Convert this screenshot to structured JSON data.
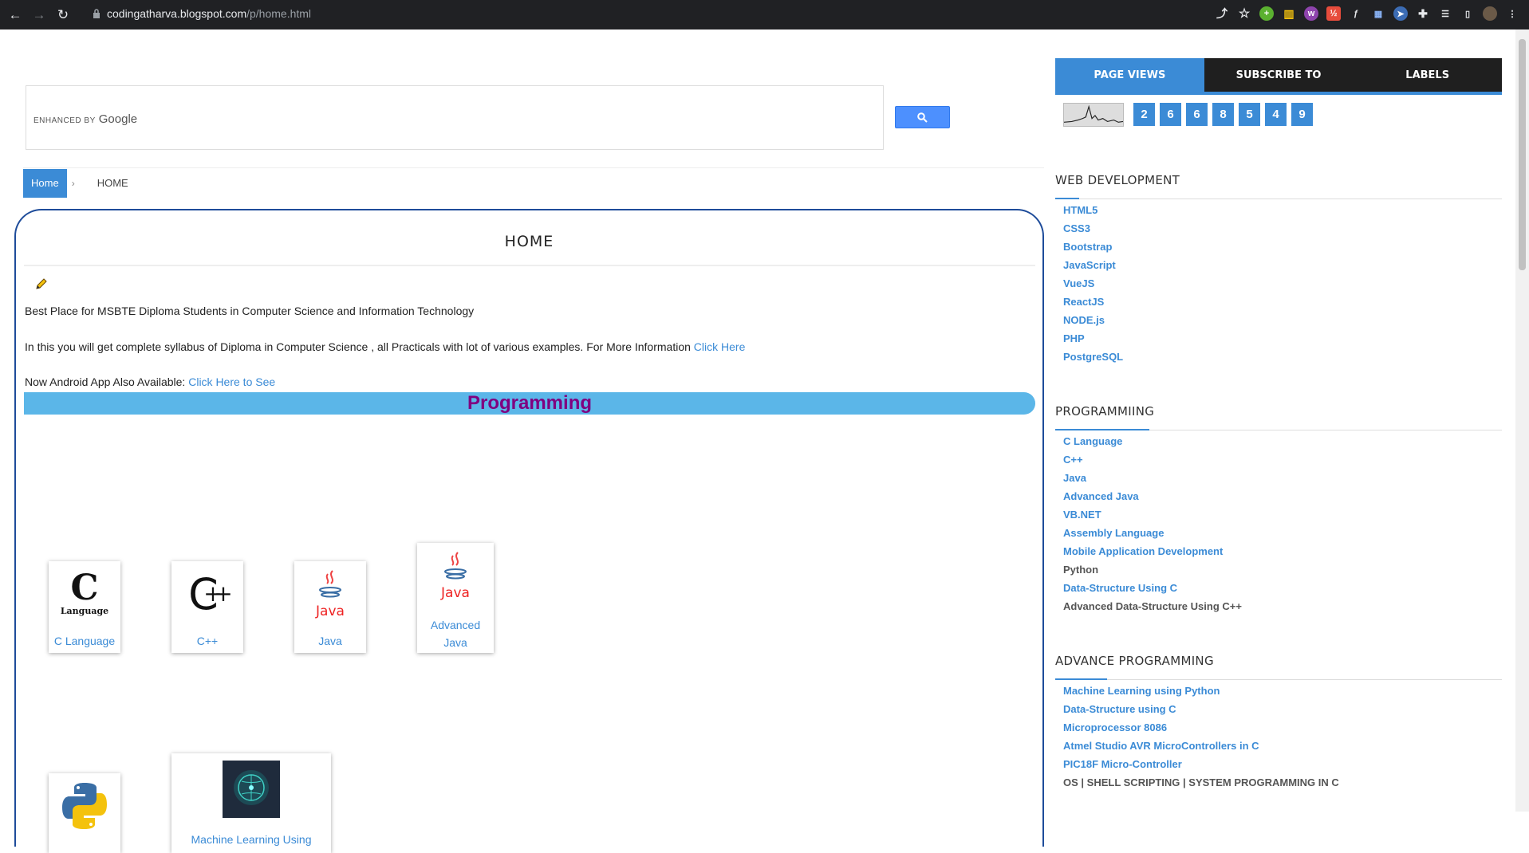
{
  "browser": {
    "url_host": "codingatharva.blogspot.com",
    "url_path": "/p/home.html"
  },
  "search": {
    "enhanced_by": "ENHANCED BY",
    "google": "Google"
  },
  "breadcrumb": {
    "home": "Home",
    "separator": "›",
    "current": "HOME"
  },
  "post": {
    "title": "HOME",
    "line1": "Best Place for MSBTE Diploma Students in Computer Science and Information Technology",
    "line2": "In this you will get complete syllabus of Diploma in Computer Science , all Practicals with lot of various examples. For More Information",
    "line2_link": "Click Here",
    "line3": "Now Android App Also Available:",
    "line3_link": "Click Here to See",
    "section_heading": "Programming"
  },
  "cards": [
    {
      "label": "C Language",
      "icon": "c-language-icon"
    },
    {
      "label": "C++",
      "icon": "cpp-icon"
    },
    {
      "label": "Java",
      "icon": "java-icon"
    },
    {
      "label": "Advanced Java",
      "icon": "java-icon"
    },
    {
      "label": "",
      "icon": "python-icon"
    },
    {
      "label": "Machine Learning Using",
      "icon": "brain-icon"
    }
  ],
  "sidebar": {
    "tabs": [
      "PAGE VIEWS",
      "SUBSCRIBE TO",
      "LABELS"
    ],
    "pageview_digits": [
      "2",
      "6",
      "6",
      "8",
      "5",
      "4",
      "9"
    ],
    "web_title": "WEB DEVELOPMENT",
    "web_items": [
      "HTML5",
      "CSS3",
      "Bootstrap",
      "JavaScript",
      "VueJS",
      "ReactJS",
      "NODE.js",
      "PHP",
      "PostgreSQL"
    ],
    "prog_title": "PROGRAMMIING",
    "prog_items": [
      "C Language",
      "C++",
      "Java",
      "Advanced Java",
      "VB.NET",
      "Assembly Language",
      "Mobile Application Development",
      "Python",
      "Data-Structure Using C",
      "Advanced Data-Structure Using C++"
    ],
    "adv_title": "ADVANCE PROGRAMMING",
    "adv_items": [
      "Machine Learning using Python",
      "Data-Structure using C",
      "Microprocessor 8086",
      "Atmel Studio AVR MicroControllers in C",
      "PIC18F Micro-Controller",
      "OS | SHELL SCRIPTING | SYSTEM PROGRAMMING IN C"
    ]
  },
  "colors": {
    "accent": "#3b8bd6",
    "heading_bar": "#5bb6e8",
    "heading_text": "#800080",
    "border": "#1e4c9a"
  }
}
